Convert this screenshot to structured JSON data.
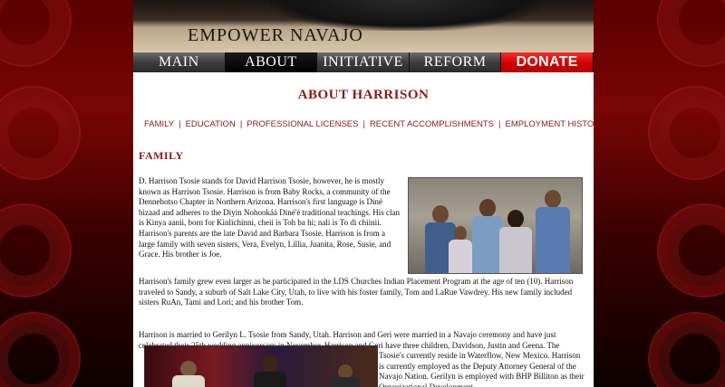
{
  "header": {
    "title": "EMPOWER NAVAJO"
  },
  "nav": {
    "items": [
      {
        "label": "MAIN"
      },
      {
        "label": "ABOUT"
      },
      {
        "label": "INITIATIVE"
      },
      {
        "label": "REFORM"
      },
      {
        "label": "DONATE"
      }
    ],
    "active": "ABOUT"
  },
  "page": {
    "title": "ABOUT HARRISON"
  },
  "subnav": {
    "items": [
      {
        "label": "FAMILY"
      },
      {
        "label": "EDUCATION"
      },
      {
        "label": "PROFESSIONAL LICENSES"
      },
      {
        "label": "RECENT ACCOMPLISHMENTS"
      },
      {
        "label": "EMPLOYMENT HISTORY"
      }
    ],
    "separator": "|"
  },
  "section": {
    "heading": "FAMILY",
    "paragraphs": [
      "D. Harrison Tsosie stands for David Harrison Tsosie, however, he is mostly known as Harrison Tsosie. Harrison is from Baby Rocks, a community of the Dennehotso Chapter in Northern Arizona. Harrison's first language is Diné bizaad and adheres to the Diyin Nohookáá Diné'é traditional teachings. His clan is Kinya aanii, born for Kinlichinni, cheii is Toh ba hi; nali is To di chiinii. Harrison's parents are the late David and Barbara Tsosie. Harrison is from a large family with seven sisters, Vera, Evelyn, Lillia, Juanita, Rose, Susie, and Grace. His brother is Joe.",
      "Harrison's family grew even larger as he participated in the LDS Churches Indian Placement Program at the age of ten (10). Harrison traveled to Sandy, a suburb of Salt Lake City, Utah, to live with his foster family, Tom and LaRue Vawdrey. His new family included sisters RuAn, Tami and Lori; and his brother Tom.",
      "Harrison is married to Gerilyn L. Tsosie from Sandy, Utah. Harrison and Geri were married in a Navajo ceremony and have just celebrated their 25th wedding anniversary in November. Harrison and Geri have three children, Davidson, Justin and Geena. The",
      "Tsosie's currently reside in Waterflow, New Mexico. Harrison is currently employed as the Deputy Attorney General of the Navajo Nation. Gerilyn is employed with BHP Billiton as their Organizational Development"
    ]
  },
  "colors": {
    "accent": "#8b1a10",
    "donate": "#d10000",
    "nav_bg": "#3d3d3d",
    "page_bg": "#5a0000"
  }
}
